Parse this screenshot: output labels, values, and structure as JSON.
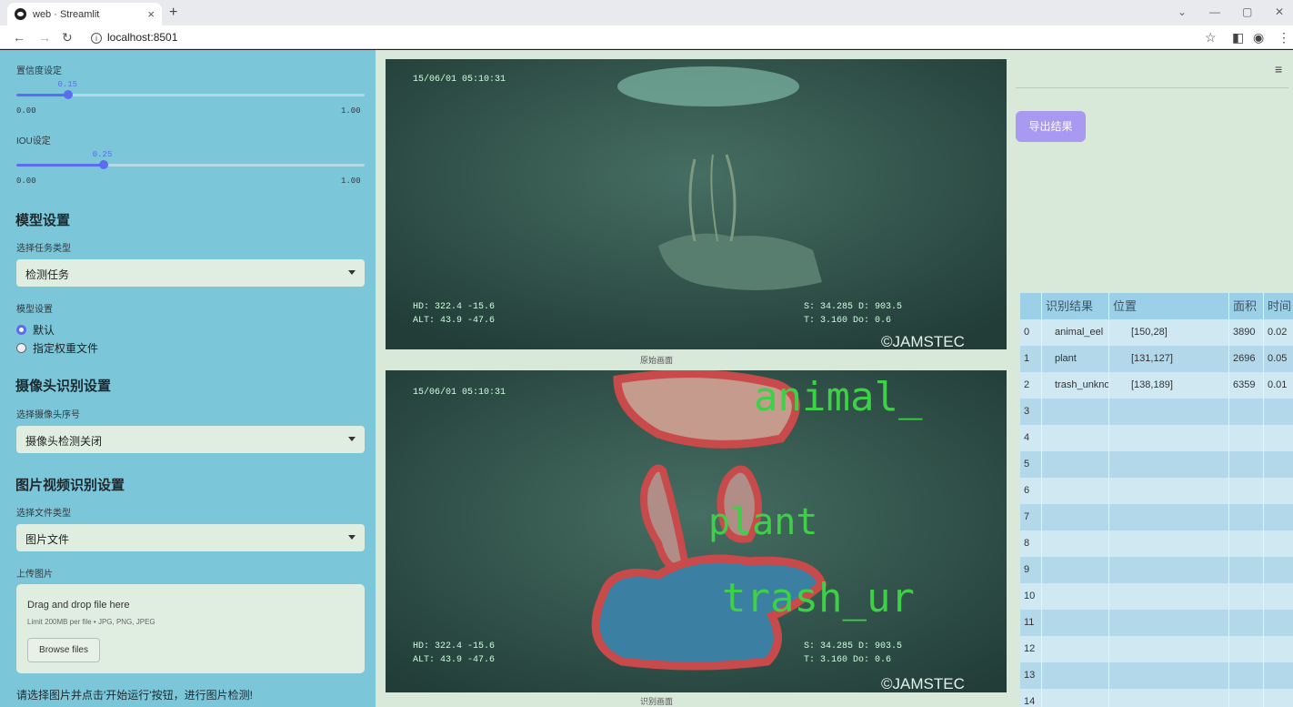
{
  "browser": {
    "tab_title": "web · Streamlit",
    "tab_close": "×",
    "new_tab": "+",
    "url": "localhost:8501",
    "controls": [
      "⌄",
      "—",
      "▢",
      "✕"
    ]
  },
  "sidebar": {
    "conf_label": "置信度设定",
    "conf_value": "0.15",
    "conf_fraction": 0.15,
    "conf_min": "0.00",
    "conf_max": "1.00",
    "iou_label": "IOU设定",
    "iou_value": "0.25",
    "iou_fraction": 0.25,
    "iou_min": "0.00",
    "iou_max": "1.00",
    "model_header": "模型设置",
    "task_label": "选择任务类型",
    "task_value": "检测任务",
    "weights_label": "模型设置",
    "radio_default": "默认",
    "radio_custom": "指定权重文件",
    "camera_header": "摄像头识别设置",
    "camera_label": "选择摄像头序号",
    "camera_value": "摄像头检测关闭",
    "media_header": "图片视频识别设置",
    "filetype_label": "选择文件类型",
    "filetype_value": "图片文件",
    "upload_label": "上传图片",
    "upload_title": "Drag and drop file here",
    "upload_limit": "Limit 200MB per file • JPG, PNG, JPEG",
    "browse_label": "Browse files",
    "hint": "请选择图片并点击'开始运行'按钮，进行图片检测!"
  },
  "main": {
    "overlay_timestamp": "15/06/01 05:10:31",
    "overlay_left1": "HD:      322.4    -15.6",
    "overlay_left2": "ALT:      43.9    -47.6",
    "overlay_right1": "S: 34.285     D: 903.5",
    "overlay_right2": "T: 3.160      Do: 0.6",
    "watermark": "©JAMSTEC",
    "original_caption": "原始画面",
    "result_caption": "识别画面",
    "label_animal": "animal_",
    "label_plant": "plant",
    "label_trash": "trash_ur"
  },
  "results": {
    "export_button": "导出结果",
    "columns": [
      "识别结果",
      "位置",
      "面积",
      "时间"
    ],
    "rows": [
      {
        "idx": "0",
        "cls": "animal_eel",
        "pos": "[150,28]",
        "area": "3890",
        "time": "0.02"
      },
      {
        "idx": "1",
        "cls": "plant",
        "pos": "[131,127]",
        "area": "2696",
        "time": "0.05"
      },
      {
        "idx": "2",
        "cls": "trash_unknown",
        "pos": "[138,189]",
        "area": "6359",
        "time": "0.01"
      },
      {
        "idx": "3",
        "cls": "",
        "pos": "",
        "area": "",
        "time": ""
      },
      {
        "idx": "4",
        "cls": "",
        "pos": "",
        "area": "",
        "time": ""
      },
      {
        "idx": "5",
        "cls": "",
        "pos": "",
        "area": "",
        "time": ""
      },
      {
        "idx": "6",
        "cls": "",
        "pos": "",
        "area": "",
        "time": ""
      },
      {
        "idx": "7",
        "cls": "",
        "pos": "",
        "area": "",
        "time": ""
      },
      {
        "idx": "8",
        "cls": "",
        "pos": "",
        "area": "",
        "time": ""
      },
      {
        "idx": "9",
        "cls": "",
        "pos": "",
        "area": "",
        "time": ""
      },
      {
        "idx": "10",
        "cls": "",
        "pos": "",
        "area": "",
        "time": ""
      },
      {
        "idx": "11",
        "cls": "",
        "pos": "",
        "area": "",
        "time": ""
      },
      {
        "idx": "12",
        "cls": "",
        "pos": "",
        "area": "",
        "time": ""
      },
      {
        "idx": "13",
        "cls": "",
        "pos": "",
        "area": "",
        "time": ""
      },
      {
        "idx": "14",
        "cls": "",
        "pos": "",
        "area": "",
        "time": ""
      }
    ]
  }
}
